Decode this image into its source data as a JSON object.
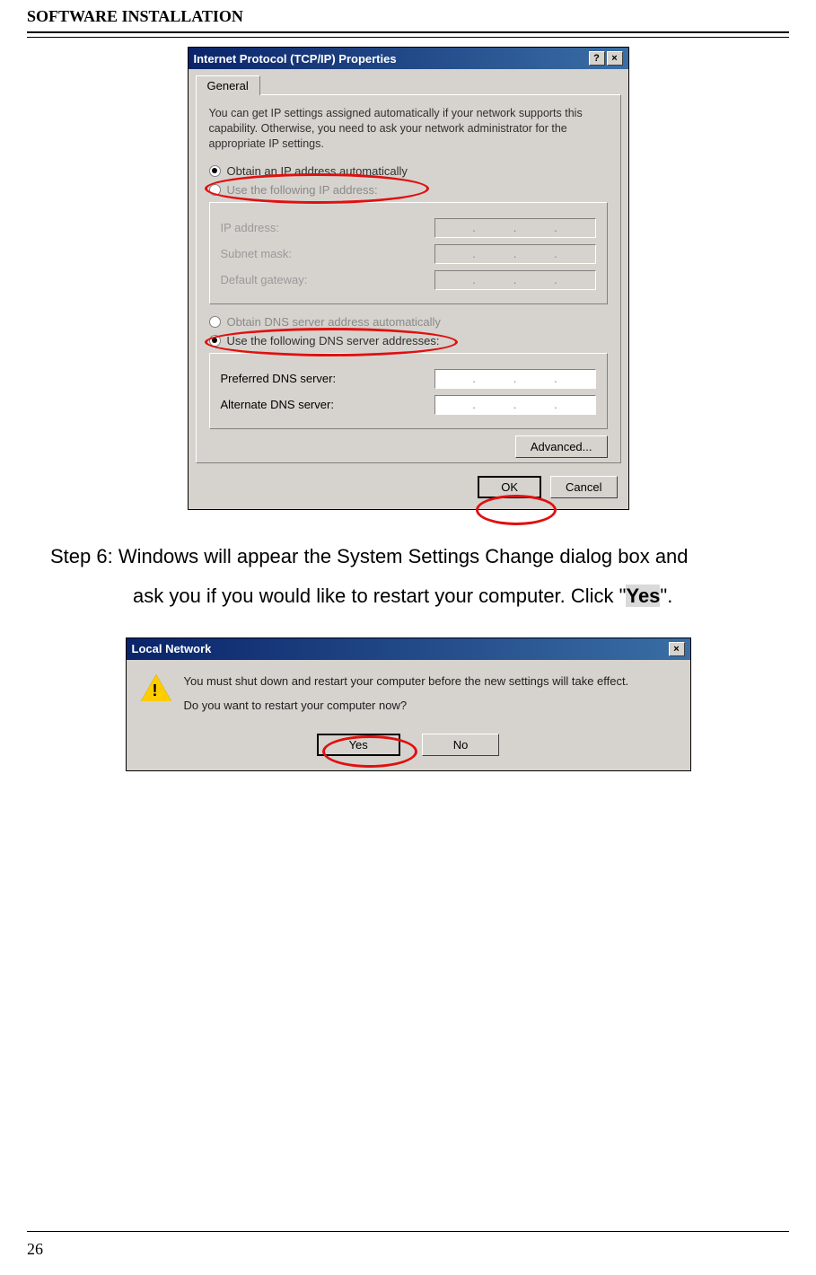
{
  "header": {
    "title": "SOFTWARE INSTALLATION"
  },
  "page_number": "26",
  "dialog1": {
    "title": "Internet Protocol (TCP/IP) Properties",
    "titlebar_help": "?",
    "titlebar_close": "×",
    "tab": {
      "general": "General"
    },
    "desc": "You can get IP settings assigned automatically if your network supports this capability. Otherwise, you need to ask your network administrator for the appropriate IP settings.",
    "radio_obtain_ip": "Obtain an IP address automatically",
    "radio_use_ip": "Use the following IP address:",
    "label_ip_address": "IP address:",
    "label_subnet": "Subnet mask:",
    "label_gateway": "Default gateway:",
    "radio_obtain_dns": "Obtain DNS server address automatically",
    "radio_use_dns": "Use the following DNS server addresses:",
    "label_pref_dns": "Preferred DNS server:",
    "label_alt_dns": "Alternate DNS server:",
    "btn_advanced": "Advanced...",
    "btn_ok": "OK",
    "btn_cancel": "Cancel"
  },
  "step6": {
    "line1": "Step 6: Windows will appear the System Settings Change dialog box and",
    "line2_pre": "ask you if you would like to restart your computer. Click \"",
    "line2_yes": "Yes",
    "line2_post": "\"."
  },
  "dialog2": {
    "title": "Local Network",
    "titlebar_close": "×",
    "msg1": "You must shut down and restart your computer before the new settings will take effect.",
    "msg2": "Do you want to restart your computer now?",
    "btn_yes": "Yes",
    "btn_no": "No"
  }
}
